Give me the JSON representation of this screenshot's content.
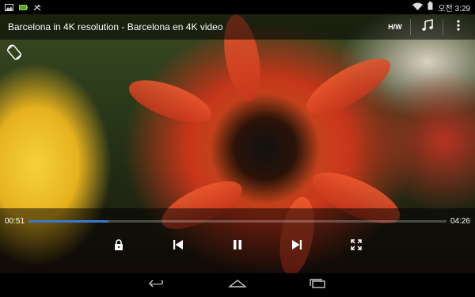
{
  "status_bar": {
    "left_icons": [
      "image-icon",
      "battery-saver-icon",
      "tool-icon"
    ],
    "right_icons": [
      "wifi-icon",
      "battery-icon"
    ],
    "time": "오전 3:29"
  },
  "title_bar": {
    "title": "Barcelona in 4K resolution - Barcelona en 4K video",
    "hw_label": "H/W",
    "icons": [
      "music-note-icon",
      "more-vert-icon"
    ]
  },
  "video": {
    "rotate_icon": "screen-rotation-icon"
  },
  "playback": {
    "current_time": "00:51",
    "total_time": "04:26",
    "progress_fraction": 0.192,
    "accent": "#3a78c8",
    "buttons": [
      "lock-icon",
      "previous-icon",
      "pause-icon",
      "next-icon",
      "fullscreen-icon"
    ]
  },
  "nav_bar": {
    "buttons": [
      "back-icon",
      "home-icon",
      "recents-icon"
    ]
  }
}
